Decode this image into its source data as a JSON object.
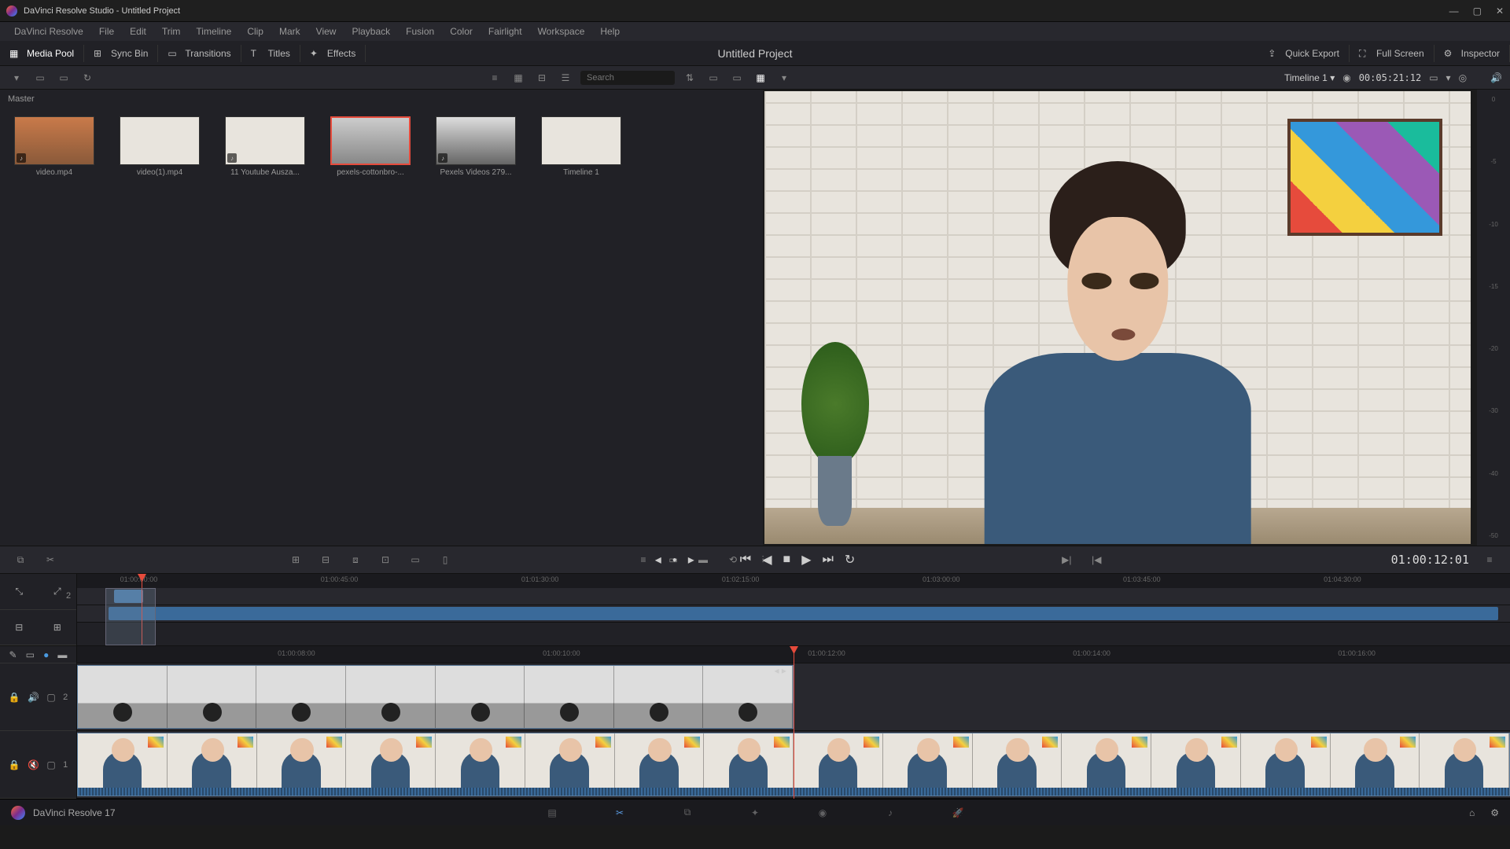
{
  "titlebar": {
    "text": "DaVinci Resolve Studio - Untitled Project"
  },
  "menubar": [
    "DaVinci Resolve",
    "File",
    "Edit",
    "Trim",
    "Timeline",
    "Clip",
    "Mark",
    "View",
    "Playback",
    "Fusion",
    "Color",
    "Fairlight",
    "Workspace",
    "Help"
  ],
  "toolbar": {
    "media_pool": "Media Pool",
    "sync_bin": "Sync Bin",
    "transitions": "Transitions",
    "titles": "Titles",
    "effects": "Effects",
    "project_title": "Untitled Project",
    "quick_export": "Quick Export",
    "full_screen": "Full Screen",
    "inspector": "Inspector"
  },
  "subtoolbar": {
    "search_placeholder": "Search",
    "timeline_name": "Timeline 1",
    "source_tc": "00:05:21:12"
  },
  "media": {
    "bin_label": "Master",
    "clips": [
      {
        "name": "video.mp4",
        "selected": false,
        "audio": true
      },
      {
        "name": "video(1).mp4",
        "selected": false,
        "audio": false
      },
      {
        "name": "11 Youtube Ausza...",
        "selected": false,
        "audio": true
      },
      {
        "name": "pexels-cottonbro-...",
        "selected": true,
        "audio": false
      },
      {
        "name": "Pexels Videos 279...",
        "selected": false,
        "audio": true
      },
      {
        "name": "Timeline 1",
        "selected": false,
        "audio": false
      }
    ]
  },
  "audio_scale": [
    "0",
    "-5",
    "-10",
    "-15",
    "-20",
    "-30",
    "-40",
    "-50"
  ],
  "transport_tc": "01:00:12:01",
  "overview_ruler": [
    {
      "pos": 3,
      "label": "01:00:00:00"
    },
    {
      "pos": 17,
      "label": "01:00:45:00"
    },
    {
      "pos": 31,
      "label": "01:01:30:00"
    },
    {
      "pos": 45,
      "label": "01:02:15:00"
    },
    {
      "pos": 59,
      "label": "01:03:00:00"
    },
    {
      "pos": 73,
      "label": "01:03:45:00"
    },
    {
      "pos": 87,
      "label": "01:04:30:00"
    }
  ],
  "overview": {
    "track2_num": "2",
    "track1_clip_start": 2.2,
    "track1_clip_width": 97,
    "track2_clip_start": 2.6,
    "track2_clip_width": 2.0,
    "playhead": 4.5
  },
  "timeline_ruler": [
    {
      "pos": 14,
      "label": "01:00:08:00"
    },
    {
      "pos": 32.5,
      "label": "01:00:10:00"
    },
    {
      "pos": 51,
      "label": "01:00:12:00"
    },
    {
      "pos": 69.5,
      "label": "01:00:14:00"
    },
    {
      "pos": 88,
      "label": "01:00:16:00"
    }
  ],
  "timeline": {
    "playhead": 50,
    "track_v2_num": "2",
    "track_v1_num": "1",
    "v2_clip_start": 0,
    "v2_clip_width": 50,
    "v1_clip_start": 0,
    "v1_clip_width": 100
  },
  "bottombar": {
    "version": "DaVinci Resolve 17"
  }
}
